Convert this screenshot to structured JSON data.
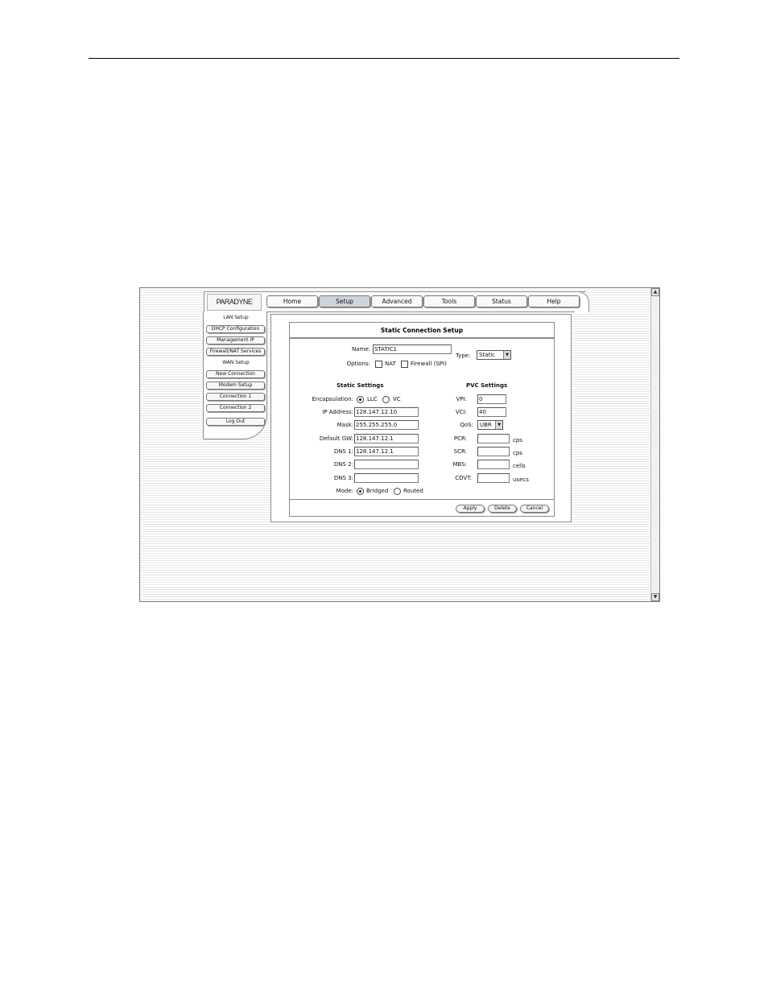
{
  "brand": {
    "logo": "PARADYNE"
  },
  "nav_tabs": [
    "Home",
    "Setup",
    "Advanced",
    "Tools",
    "Status",
    "Help"
  ],
  "active_tab": "Setup",
  "sidebar": {
    "lan_header": "LAN Setup",
    "lan_items": [
      "DHCP Configuration",
      "Management IP",
      "Firewall/NAT Services"
    ],
    "wan_header": "WAN Setup",
    "wan_items": [
      "New Connection",
      "Modem Setup",
      "Connection 1",
      "Connection 2"
    ],
    "logout": "Log Out"
  },
  "form": {
    "title": "Static Connection Setup",
    "name_label": "Name:",
    "name_value": "STATIC1",
    "type_label": "Type:",
    "type_value": "Static",
    "options_label": "Options:",
    "option_nat": "NAT",
    "option_firewall": "Firewall (SPI)",
    "static_settings": {
      "header": "Static Settings",
      "encapsulation_label": "Encapsulation:",
      "encap_llc": "LLC",
      "encap_vc": "VC",
      "ip_label": "IP Address:",
      "ip_value": "128.147.12.10",
      "mask_label": "Mask:",
      "mask_value": "255.255.255.0",
      "gw_label": "Default GW:",
      "gw_value": "128.147.12.1",
      "dns1_label": "DNS 1:",
      "dns1_value": "128.147.12.1",
      "dns2_label": "DNS 2:",
      "dns2_value": "",
      "dns3_label": "DNS 3:",
      "dns3_value": "",
      "mode_label": "Mode:",
      "mode_bridged": "Bridged",
      "mode_routed": "Routed"
    },
    "pvc_settings": {
      "header": "PVC Settings",
      "vpi_label": "VPI:",
      "vpi_value": "0",
      "vci_label": "VCI:",
      "vci_value": "40",
      "qos_label": "QoS:",
      "qos_value": "UBR",
      "pcr_label": "PCR:",
      "pcr_unit": "cps",
      "scr_label": "SCR:",
      "scr_unit": "cps",
      "mbs_label": "MBS:",
      "mbs_unit": "cells",
      "cdvt_label": "CDVT:",
      "cdvt_unit": "usecs"
    },
    "buttons": {
      "apply": "Apply",
      "delete": "Delete",
      "cancel": "Cancel"
    }
  }
}
